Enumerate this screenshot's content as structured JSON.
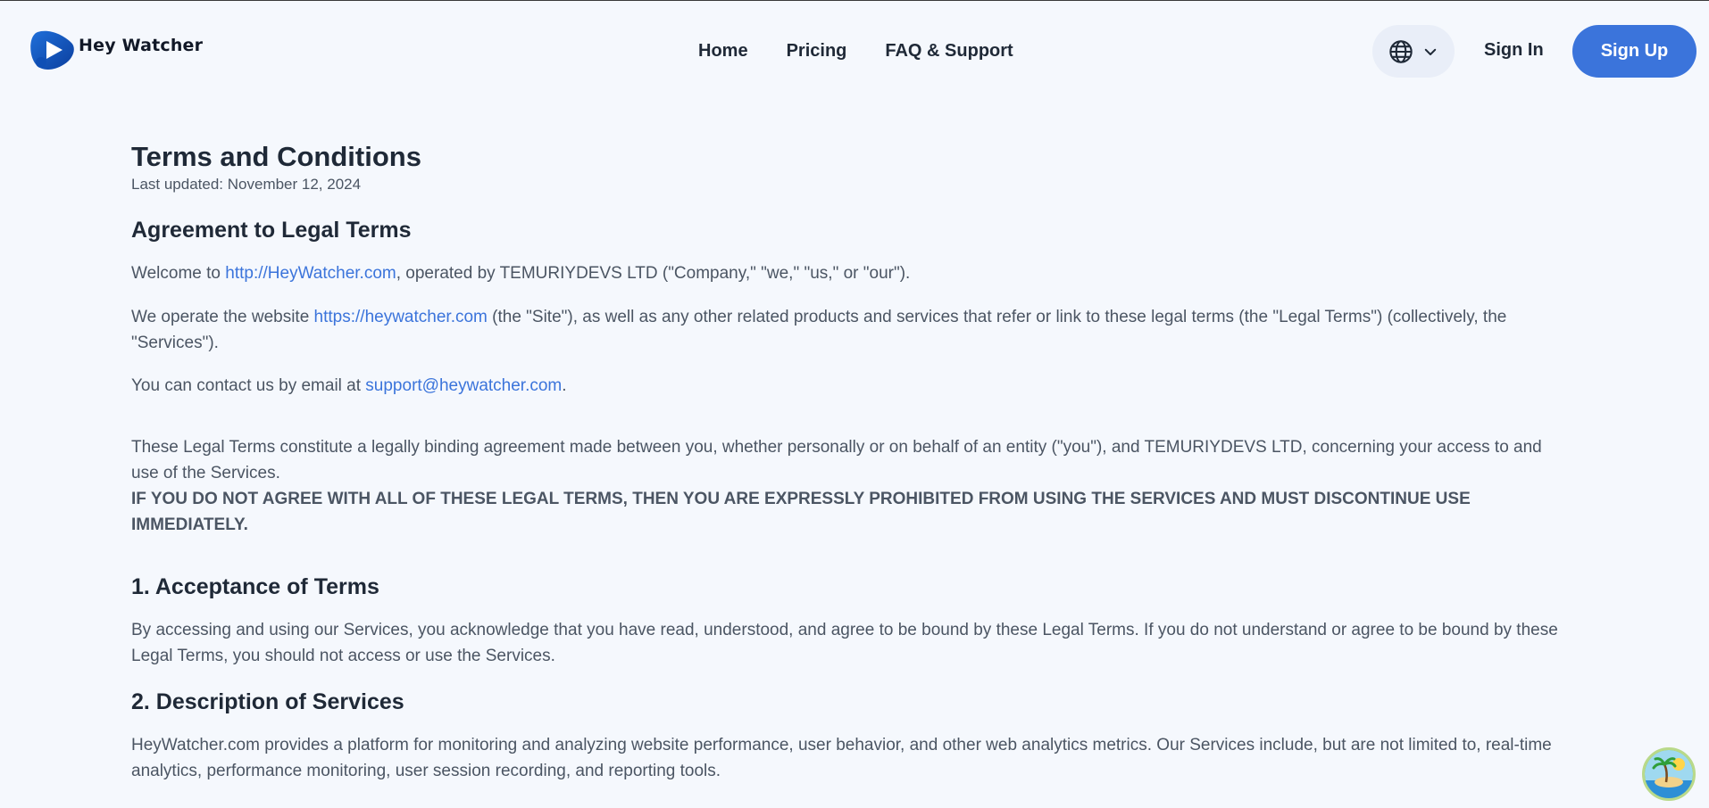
{
  "brand": {
    "name": "Hey Watcher"
  },
  "nav": {
    "home": "Home",
    "pricing": "Pricing",
    "faq": "FAQ & Support"
  },
  "actions": {
    "signin": "Sign In",
    "signup": "Sign Up"
  },
  "colors": {
    "accent": "#3b74db",
    "text_dark": "#1f2937",
    "text_body": "#4b5563",
    "background": "#f5f8fd"
  },
  "icons": {
    "lang": "globe-icon",
    "chevron": "chevron-down-icon"
  },
  "doc": {
    "title": "Terms and Conditions",
    "updated": "Last updated: November 12, 2024",
    "agreement_heading": "Agreement to Legal Terms",
    "p1_before": "Welcome to ",
    "p1_link": "http://HeyWatcher.com",
    "p1_after": ", operated by TEMURIYDEVS LTD (\"Company,\" \"we,\" \"us,\" or \"our\").",
    "p2_before": "We operate the website ",
    "p2_link": "https://heywatcher.com",
    "p2_after": " (the \"Site\"), as well as any other related products and services that refer or link to these legal terms (the \"Legal Terms\") (collectively, the \"Services\").",
    "p3_before": "You can contact us by email at ",
    "p3_link": "support@heywatcher.com",
    "p3_after": ".",
    "p4": "These Legal Terms constitute a legally binding agreement made between you, whether personally or on behalf of an entity (\"you\"), and TEMURIYDEVS LTD, concerning your access to and use of the Services.",
    "warning": "IF YOU DO NOT AGREE WITH ALL OF THESE LEGAL TERMS, THEN YOU ARE EXPRESSLY PROHIBITED FROM USING THE SERVICES AND MUST DISCONTINUE USE IMMEDIATELY.",
    "s1_heading": "1. Acceptance of Terms",
    "s1_text": "By accessing and using our Services, you acknowledge that you have read, understood, and agree to be bound by these Legal Terms. If you do not understand or agree to be bound by these Legal Terms, you should not access or use the Services.",
    "s2_heading": "2. Description of Services",
    "s2_text": "HeyWatcher.com provides a platform for monitoring and analyzing website performance, user behavior, and other web analytics metrics. Our Services include, but are not limited to, real-time analytics, performance monitoring, user session recording, and reporting tools."
  }
}
